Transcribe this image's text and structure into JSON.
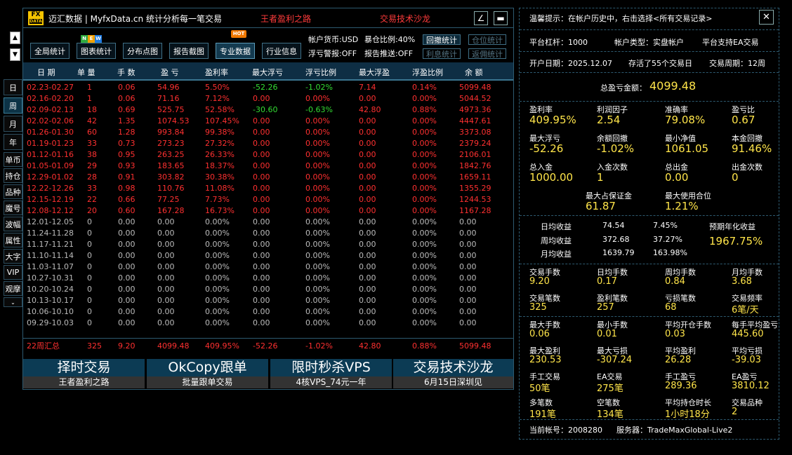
{
  "title": {
    "logo_top": "FX",
    "logo_bottom": "DATA",
    "app_name": "迈汇数据 | MyfxData.cn  统计分析每一笔交易",
    "link1": "王者盈利之路",
    "link2": "交易技术沙龙",
    "edit_icon": "∠",
    "min_icon": "▬"
  },
  "toolbar": {
    "buttons": [
      "全局统计",
      "图表统计",
      "分布点图",
      "报告截图",
      "专业数据",
      "行业信息"
    ],
    "badge_new": [
      "N",
      "E",
      "W"
    ],
    "badge_hot": "HOT",
    "currency": "帐户货币:USD",
    "exposure": "暴仓比例:40%",
    "float_alert": "浮亏警报:OFF",
    "report_push": "报告推送:OFF",
    "small_buttons": [
      "回撤统计",
      "仓位统计",
      "利息统计",
      "返佣统计"
    ]
  },
  "rail": {
    "up": "▲",
    "down": "▼",
    "items": [
      "日",
      "周",
      "月",
      "年",
      "单币",
      "持仓",
      "品种",
      "魔号",
      "波幅",
      "属性",
      "大字",
      "VIP",
      "观摩"
    ],
    "chevron": "⌄"
  },
  "table": {
    "headers": [
      "日 期",
      "单 量",
      "手 数",
      "盈 亏",
      "盈利率",
      "最大浮亏",
      "浮亏比例",
      "最大浮盈",
      "浮盈比例",
      "余 额"
    ],
    "rows": [
      [
        "02.23-02.27",
        "1",
        "0.06",
        "54.96",
        "5.50%",
        "-52.26",
        "-1.02%",
        "7.14",
        "0.14%",
        "5099.48"
      ],
      [
        "02.16-02.20",
        "1",
        "0.06",
        "71.16",
        "7.12%",
        "0.00",
        "0.00%",
        "0.00",
        "0.00%",
        "5044.52"
      ],
      [
        "02.09-02.13",
        "18",
        "0.69",
        "525.75",
        "52.58%",
        "-30.60",
        "-0.63%",
        "42.80",
        "0.88%",
        "4973.36"
      ],
      [
        "02.02-02.06",
        "42",
        "1.35",
        "1074.53",
        "107.45%",
        "0.00",
        "0.00%",
        "0.00",
        "0.00%",
        "4447.61"
      ],
      [
        "01.26-01.30",
        "60",
        "1.28",
        "993.84",
        "99.38%",
        "0.00",
        "0.00%",
        "0.00",
        "0.00%",
        "3373.08"
      ],
      [
        "01.19-01.23",
        "33",
        "0.73",
        "273.23",
        "27.32%",
        "0.00",
        "0.00%",
        "0.00",
        "0.00%",
        "2379.24"
      ],
      [
        "01.12-01.16",
        "38",
        "0.95",
        "263.25",
        "26.33%",
        "0.00",
        "0.00%",
        "0.00",
        "0.00%",
        "2106.01"
      ],
      [
        "01.05-01.09",
        "29",
        "0.93",
        "183.65",
        "18.37%",
        "0.00",
        "0.00%",
        "0.00",
        "0.00%",
        "1842.76"
      ],
      [
        "12.29-01.02",
        "28",
        "0.91",
        "303.82",
        "30.38%",
        "0.00",
        "0.00%",
        "0.00",
        "0.00%",
        "1659.11"
      ],
      [
        "12.22-12.26",
        "33",
        "0.98",
        "110.76",
        "11.08%",
        "0.00",
        "0.00%",
        "0.00",
        "0.00%",
        "1355.29"
      ],
      [
        "12.15-12.19",
        "22",
        "0.66",
        "77.25",
        "7.73%",
        "0.00",
        "0.00%",
        "0.00",
        "0.00%",
        "1244.53"
      ],
      [
        "12.08-12.12",
        "20",
        "0.60",
        "167.28",
        "16.73%",
        "0.00",
        "0.00%",
        "0.00",
        "0.00%",
        "1167.28"
      ],
      [
        "12.01-12.05",
        "0",
        "0.00",
        "0.00",
        "0.00%",
        "0.00",
        "0.00%",
        "0.00",
        "0.00%",
        "0.00"
      ],
      [
        "11.24-11.28",
        "0",
        "0.00",
        "0.00",
        "0.00%",
        "0.00",
        "0.00%",
        "0.00",
        "0.00%",
        "0.00"
      ],
      [
        "11.17-11.21",
        "0",
        "0.00",
        "0.00",
        "0.00%",
        "0.00",
        "0.00%",
        "0.00",
        "0.00%",
        "0.00"
      ],
      [
        "11.10-11.14",
        "0",
        "0.00",
        "0.00",
        "0.00%",
        "0.00",
        "0.00%",
        "0.00",
        "0.00%",
        "0.00"
      ],
      [
        "11.03-11.07",
        "0",
        "0.00",
        "0.00",
        "0.00%",
        "0.00",
        "0.00%",
        "0.00",
        "0.00%",
        "0.00"
      ],
      [
        "10.27-10.31",
        "0",
        "0.00",
        "0.00",
        "0.00%",
        "0.00",
        "0.00%",
        "0.00",
        "0.00%",
        "0.00"
      ],
      [
        "10.20-10.24",
        "0",
        "0.00",
        "0.00",
        "0.00%",
        "0.00",
        "0.00%",
        "0.00",
        "0.00%",
        "0.00"
      ],
      [
        "10.13-10.17",
        "0",
        "0.00",
        "0.00",
        "0.00%",
        "0.00",
        "0.00%",
        "0.00",
        "0.00%",
        "0.00"
      ],
      [
        "10.06-10.10",
        "0",
        "0.00",
        "0.00",
        "0.00%",
        "0.00",
        "0.00%",
        "0.00",
        "0.00%",
        "0.00"
      ],
      [
        "09.29-10.03",
        "0",
        "0.00",
        "0.00",
        "0.00%",
        "0.00",
        "0.00%",
        "0.00",
        "0.00%",
        "0.00"
      ]
    ],
    "summary": [
      "22周汇总",
      "325",
      "9.20",
      "4099.48",
      "409.95%",
      "-52.26",
      "-1.02%",
      "42.80",
      "0.88%",
      "5099.48"
    ]
  },
  "promos": [
    {
      "title": "择时交易",
      "sub": "王者盈利之路"
    },
    {
      "title": "OkCopy跟单",
      "sub": "批量跟单交易"
    },
    {
      "title": "限时秒杀VPS",
      "sub": "4核VPS_74元一年"
    },
    {
      "title": "交易技术沙龙",
      "sub": "6月15日深圳见"
    }
  ],
  "right": {
    "tip": "温馨提示：在帐户历史中，右击选择<所有交易记录>",
    "close": "✕",
    "leverage": "平台杠杆：1000",
    "acct_type": "帐户类型：实盘帐户",
    "ea": "平台支持EA交易",
    "open_date": "开户日期：2025.12.07",
    "existed": "存活了55个交易日",
    "cycle": "交易周期：12周",
    "total_label": "总盈亏金额：",
    "total_value": "4099.48",
    "grid1": [
      {
        "label": "盈利率",
        "value": "409.95%"
      },
      {
        "label": "利润因子",
        "value": "2.54"
      },
      {
        "label": "准确率",
        "value": "79.08%"
      },
      {
        "label": "盈亏比",
        "value": "0.67"
      },
      {
        "label": "最大浮亏",
        "value": "-52.26"
      },
      {
        "label": "余额回撤",
        "value": "-1.02%"
      },
      {
        "label": "最小净值",
        "value": "1061.05"
      },
      {
        "label": "本金回撤",
        "value": "91.46%"
      },
      {
        "label": "总入金",
        "value": "1000.00"
      },
      {
        "label": "入金次数",
        "value": "1"
      },
      {
        "label": "总出金",
        "value": "0.00"
      },
      {
        "label": "出金次数",
        "value": "0"
      }
    ],
    "margin_label": "最大占保证金",
    "margin_value": "61.87",
    "pos_label": "最大使用合位",
    "pos_value": "1.21%",
    "returns": {
      "day_label": "日均收益",
      "day_amt": "74.54",
      "day_pct": "7.45%",
      "week_label": "周均收益",
      "week_amt": "372.68",
      "week_pct": "37.27%",
      "month_label": "月均收益",
      "month_amt": "1639.79",
      "month_pct": "163.98%",
      "annual_label": "预期年化收益",
      "annual_value": "1967.75%"
    },
    "grid2": [
      {
        "label": "交易手数",
        "value": "9.20"
      },
      {
        "label": "日均手数",
        "value": "0.17"
      },
      {
        "label": "周均手数",
        "value": "0.84"
      },
      {
        "label": "月均手数",
        "value": "3.68"
      },
      {
        "label": "交易笔数",
        "value": "325"
      },
      {
        "label": "盈利笔数",
        "value": "257"
      },
      {
        "label": "亏损笔数",
        "value": "68"
      },
      {
        "label": "交易频率",
        "value": "6笔/天"
      }
    ],
    "grid3": [
      {
        "label": "最大手数",
        "value": "0.06"
      },
      {
        "label": "最小手数",
        "value": "0.01"
      },
      {
        "label": "平均开仓手数",
        "value": "0.03"
      },
      {
        "label": "每手平均盈亏",
        "value": "445.60"
      },
      {
        "label": "最大盈利",
        "value": "230.53"
      },
      {
        "label": "最大亏损",
        "value": "-307.24"
      },
      {
        "label": "平均盈利",
        "value": "26.28"
      },
      {
        "label": "平均亏损",
        "value": "-39.03"
      },
      {
        "label": "手工交易",
        "value": "50笔"
      },
      {
        "label": "EA交易",
        "value": "275笔"
      },
      {
        "label": "手工盈亏",
        "value": "289.36"
      },
      {
        "label": "EA盈亏",
        "value": "3810.12"
      },
      {
        "label": "多笔数",
        "value": "191笔"
      },
      {
        "label": "空笔数",
        "value": "134笔"
      },
      {
        "label": "平均持仓时长",
        "value": "1小时18分"
      },
      {
        "label": "交易品种",
        "value": " 2"
      }
    ],
    "account": "当前帐号：2008280",
    "server": "服务器：TradeMaxGlobal-Live2"
  }
}
